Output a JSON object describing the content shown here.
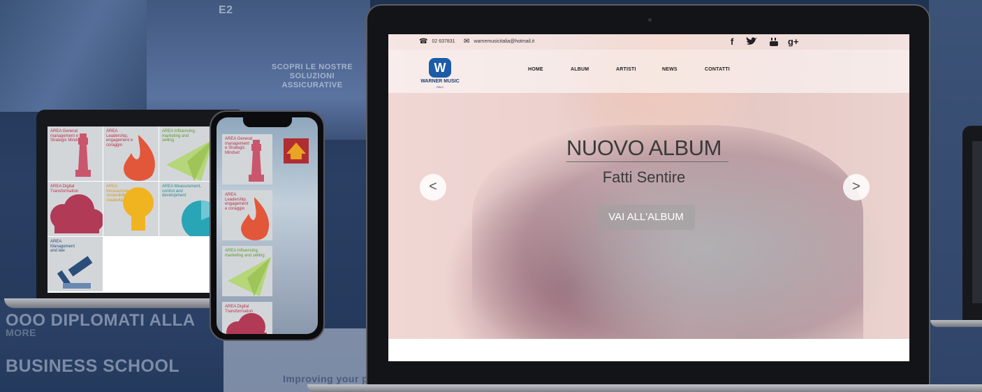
{
  "background": {
    "scopri": "SCOPRI LE NOSTRE SOLUZIONI ASSICURATIVE",
    "school_line1": "OOO DIPLOMATI ALLA",
    "school_line2": "MORE",
    "school_line3": "BUSINESS SCHOOL",
    "improving": "Improving your p",
    "logo_e2": "E2"
  },
  "small_laptop": {
    "tiles": [
      {
        "label": "AREA General management e Strategic Mindset",
        "icon": "chess-king-icon",
        "color": "#b8324a"
      },
      {
        "label": "AREA Leadership, engagement e coraggio",
        "icon": "flame-icon",
        "color": "#e2573a"
      },
      {
        "label": "AREA Influencing, marketing and selling",
        "icon": "paper-plane-icon",
        "color": "#9fc55a"
      },
      {
        "label": "AREA Digital Transformation",
        "icon": "cloud-icon",
        "color": "#b13a56"
      },
      {
        "label": "AREA Innovazione, sostenibilità e creatività",
        "icon": "lightbulb-icon",
        "color": "#f0b420"
      },
      {
        "label": "AREA Measurement, control and development",
        "icon": "pie-chart-icon",
        "color": "#2aa5b5"
      },
      {
        "label": "AREA Management and law",
        "icon": "gavel-icon",
        "color": "#2b4d7c"
      }
    ]
  },
  "phone": {
    "tiles": [
      {
        "label": "AREA General management e Strategic Mindset",
        "icon": "chess-king-icon"
      },
      {
        "label": "AREA Leadership, engagement e coraggio",
        "icon": "flame-icon"
      },
      {
        "label": "AREA Influencing, marketing and selling",
        "icon": "paper-plane-icon"
      },
      {
        "label": "AREA Digital Transformation",
        "icon": "cloud-icon"
      }
    ],
    "badge_icon": "house-icon"
  },
  "site": {
    "phone_number": "02 637831",
    "email": "warnemusicitalia@hotmail.it",
    "social": {
      "facebook": "f",
      "twitter": "🐦",
      "youtube": "You",
      "googleplus": "g+"
    },
    "logo_mark": "W",
    "logo_name": "WARNER MUSIC",
    "logo_sub": "ITALY",
    "nav": {
      "home": "HOME",
      "album": "ALBUM",
      "artisti": "ARTISTI",
      "news": "NEWS",
      "contatti": "CONTATTI"
    },
    "hero": {
      "title": "NUOVO ALBUM",
      "subtitle": "Fatti Sentire",
      "button": "VAI ALL'ALBUM",
      "prev": "<",
      "next": ">"
    }
  }
}
